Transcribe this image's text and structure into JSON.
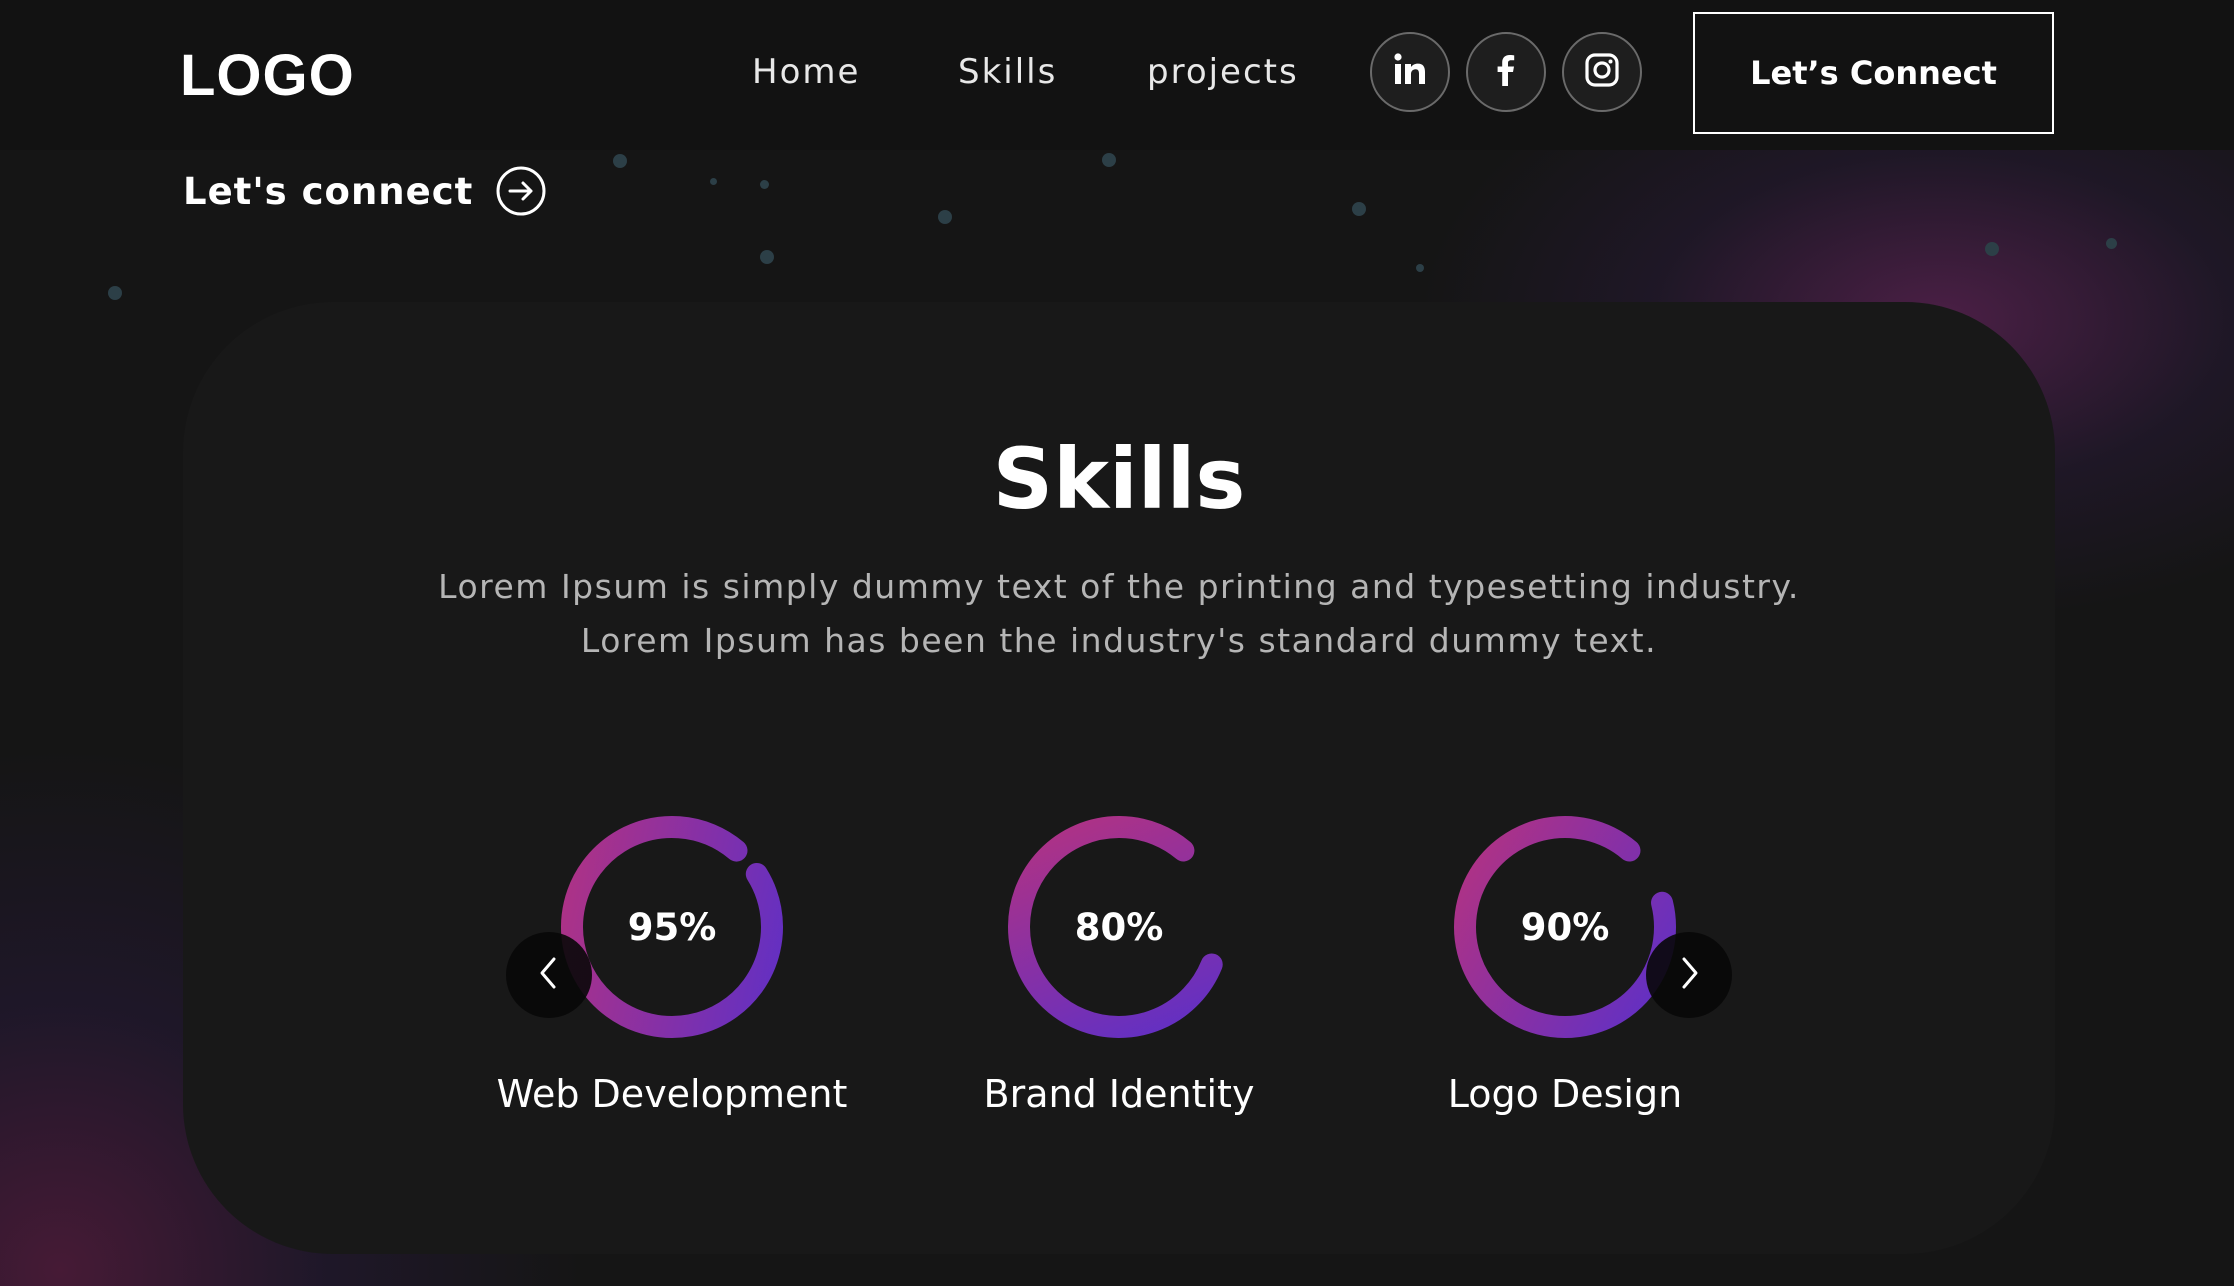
{
  "navbar": {
    "logo": "LOGO",
    "links": [
      {
        "label": "Home"
      },
      {
        "label": "Skills"
      },
      {
        "label": "projects"
      }
    ],
    "social": [
      {
        "icon": "linkedin-icon"
      },
      {
        "icon": "facebook-icon"
      },
      {
        "icon": "instagram-icon"
      }
    ],
    "cta_label": "Let’s Connect"
  },
  "hero": {
    "connect_label": "Let's connect"
  },
  "skills": {
    "title": "Skills",
    "description_line1": "Lorem Ipsum is simply dummy text of the printing and typesetting industry.",
    "description_line2": "Lorem Ipsum has been the industry's standard dummy text.",
    "items": [
      {
        "name": "Web Development",
        "percent_label": "95%",
        "percent": 95
      },
      {
        "name": "Brand Identity",
        "percent_label": "80%",
        "percent": 80
      },
      {
        "name": "Logo Design",
        "percent_label": "90%",
        "percent": 90
      }
    ]
  },
  "colors": {
    "background": "#121212",
    "card": "#181818",
    "ring_start": "#b6327f",
    "ring_end": "#5b2fc9"
  }
}
